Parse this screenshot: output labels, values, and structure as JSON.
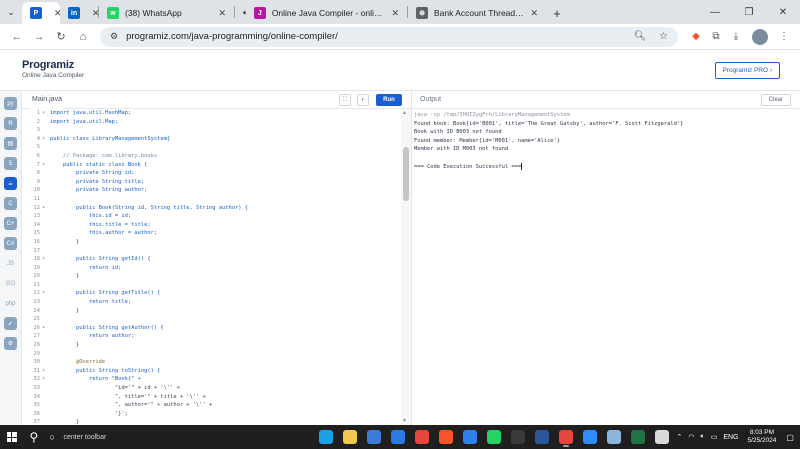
{
  "browser": {
    "tabs": [
      {
        "title": "",
        "icon": "programiz-icon",
        "active": true,
        "fav_color": "#1a5fd0",
        "fav_text": "P"
      },
      {
        "title": "",
        "icon": "linkedin-icon",
        "active": false,
        "fav_color": "#0a66c2",
        "fav_text": "in"
      },
      {
        "title": "(38) WhatsApp",
        "icon": "whatsapp-icon",
        "active": false,
        "fav_color": "#25d366",
        "fav_text": "w"
      },
      {
        "title": "Online Java Compiler - online e",
        "icon": "java-compiler-icon",
        "active": false,
        "muted": true,
        "fav_color": "#b5179e",
        "fav_text": "J"
      },
      {
        "title": "Bank Account Threads Simulati",
        "icon": "chatgpt-icon",
        "active": false,
        "fav_color": "#5f6368",
        "fav_text": "⊛"
      }
    ],
    "url": "programiz.com/java-programming/online-compiler/"
  },
  "site": {
    "logo_text": "Programiz",
    "logo_sub": "Online Java Compiler",
    "pro_button": "Programiz PRO ›"
  },
  "rail": {
    "icons": [
      "python-icon",
      "r-icon",
      "sql-icon",
      "html-icon",
      "java-icon",
      "c-icon",
      "cpp-icon",
      "csharp-icon",
      "js-icon",
      "go-icon",
      "php-icon",
      "swift-icon",
      "rust-icon"
    ]
  },
  "editor": {
    "file_name": "Main.java",
    "run_label": "Run",
    "lines": [
      {
        "n": "1",
        "f": "▾",
        "t": "import java.util.HashMap;"
      },
      {
        "n": "2",
        "f": "",
        "t": "import java.util.Map;"
      },
      {
        "n": "3",
        "f": "",
        "t": ""
      },
      {
        "n": "4",
        "f": "▾",
        "t": "public class LibraryManagementSystem{"
      },
      {
        "n": "5",
        "f": "",
        "t": ""
      },
      {
        "n": "6",
        "f": "",
        "t": "    // Package: com.library.books"
      },
      {
        "n": "7",
        "f": "▾",
        "t": "    public static class Book {"
      },
      {
        "n": "8",
        "f": "",
        "t": "        private String id;"
      },
      {
        "n": "9",
        "f": "",
        "t": "        private String title;"
      },
      {
        "n": "10",
        "f": "",
        "t": "        private String author;"
      },
      {
        "n": "11",
        "f": "",
        "t": ""
      },
      {
        "n": "12",
        "f": "▾",
        "t": "        public Book(String id, String title, String author) {"
      },
      {
        "n": "13",
        "f": "",
        "t": "            this.id = id;"
      },
      {
        "n": "14",
        "f": "",
        "t": "            this.title = title;"
      },
      {
        "n": "15",
        "f": "",
        "t": "            this.author = author;"
      },
      {
        "n": "16",
        "f": "",
        "t": "        }"
      },
      {
        "n": "17",
        "f": "",
        "t": ""
      },
      {
        "n": "18",
        "f": "▾",
        "t": "        public String getId() {"
      },
      {
        "n": "19",
        "f": "",
        "t": "            return id;"
      },
      {
        "n": "20",
        "f": "",
        "t": "        }"
      },
      {
        "n": "21",
        "f": "",
        "t": ""
      },
      {
        "n": "22",
        "f": "▾",
        "t": "        public String getTitle() {"
      },
      {
        "n": "23",
        "f": "",
        "t": "            return title;"
      },
      {
        "n": "24",
        "f": "",
        "t": "        }"
      },
      {
        "n": "25",
        "f": "",
        "t": ""
      },
      {
        "n": "26",
        "f": "▾",
        "t": "        public String getAuthor() {"
      },
      {
        "n": "27",
        "f": "",
        "t": "            return author;"
      },
      {
        "n": "28",
        "f": "",
        "t": "        }"
      },
      {
        "n": "29",
        "f": "",
        "t": ""
      },
      {
        "n": "30",
        "f": "",
        "t": "        @Override"
      },
      {
        "n": "31",
        "f": "▾",
        "t": "        public String toString() {"
      },
      {
        "n": "32",
        "f": "▾",
        "t": "            return \"Book{\" +"
      },
      {
        "n": "33",
        "f": "",
        "t": "                    \"id='\" + id + '\\'' +"
      },
      {
        "n": "34",
        "f": "",
        "t": "                    \", title='\" + title + '\\'' +"
      },
      {
        "n": "35",
        "f": "",
        "t": "                    \", author='\" + author + '\\'' +"
      },
      {
        "n": "36",
        "f": "",
        "t": "                    '}';"
      },
      {
        "n": "37",
        "f": "",
        "t": "        }"
      }
    ]
  },
  "output": {
    "title": "Output",
    "clear_label": "Clear",
    "lines": [
      {
        "t": "java -cp /tmp/IHQIZygFrh/LibraryManagementSystem",
        "cls": "cmd"
      },
      {
        "t": "Found book: Book{id='B001', title='The Great Gatsby', author='F. Scott Fitzgerald'}",
        "cls": ""
      },
      {
        "t": "Book with ID B003 not found",
        "cls": ""
      },
      {
        "t": "Found member: Member{id='M001', name='Alice'}",
        "cls": ""
      },
      {
        "t": "Member with ID M003 not found",
        "cls": ""
      },
      {
        "t": "",
        "cls": ""
      },
      {
        "t": "=== Code Execution Successful ===",
        "cls": "",
        "cursor": true
      }
    ]
  },
  "taskbar": {
    "search_text": "center toolbar",
    "apps": [
      {
        "name": "edge-icon",
        "color": "#1da1e6"
      },
      {
        "name": "file-explorer-icon",
        "color": "#f2c94c"
      },
      {
        "name": "store-icon",
        "color": "#3d7bd9"
      },
      {
        "name": "mail-icon",
        "color": "#2c7be5"
      },
      {
        "name": "chrome-icon",
        "color": "#e8453c"
      },
      {
        "name": "brave-icon",
        "color": "#fb542b"
      },
      {
        "name": "vscode-icon",
        "color": "#2f80ed"
      },
      {
        "name": "whatsapp-icon",
        "color": "#25d366"
      },
      {
        "name": "terminal-icon",
        "color": "#3a3a3a"
      },
      {
        "name": "word-icon",
        "color": "#2b579a"
      },
      {
        "name": "chrome-active-icon",
        "color": "#e8453c",
        "running": true
      },
      {
        "name": "zoom-icon",
        "color": "#2d8cff"
      },
      {
        "name": "notepad-icon",
        "color": "#8fb4d9"
      },
      {
        "name": "excel-icon",
        "color": "#217346"
      },
      {
        "name": "files-icon",
        "color": "#d9d9d9"
      }
    ],
    "tray_lang": "ENG",
    "time": "8:03 PM",
    "date": "5/25/2024"
  }
}
